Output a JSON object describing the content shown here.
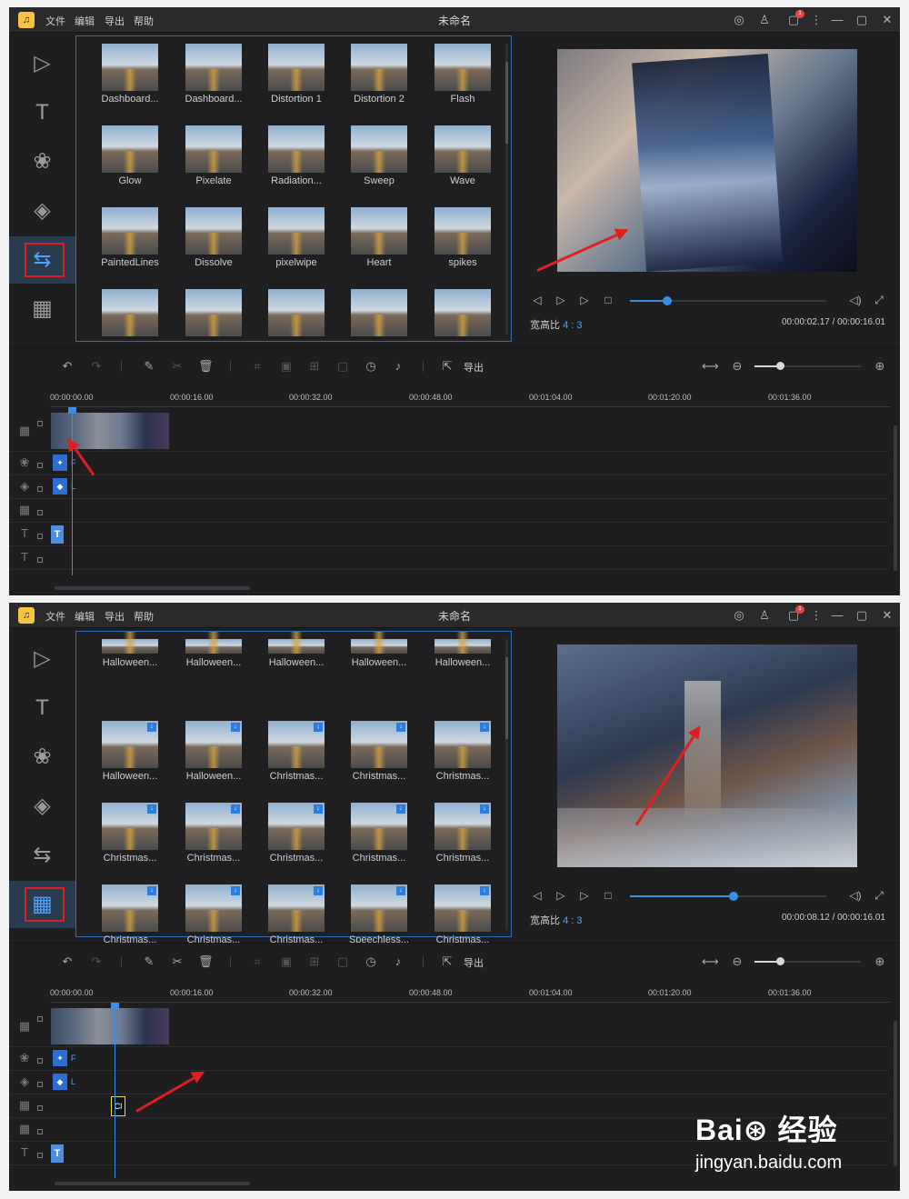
{
  "app": {
    "window_title": "未命名",
    "logo_glyph": "♫",
    "menu": [
      "文件",
      "编辑",
      "导出",
      "帮助"
    ],
    "notification_badge": "1"
  },
  "sidebar": [
    "media",
    "text",
    "filters",
    "overlays",
    "transitions",
    "elements"
  ],
  "screens": [
    {
      "active_sidebar": "transitions",
      "grid_items": [
        "Dashboard...",
        "Dashboard...",
        "Distortion 1",
        "Distortion 2",
        "Flash",
        "Glow",
        "Pixelate",
        "Radiation...",
        "Sweep",
        "Wave",
        "PaintedLines",
        "Dissolve",
        "pixelwipe",
        "Heart",
        "spikes",
        "",
        "",
        "",
        "",
        ""
      ],
      "aspect_label": "宽高比",
      "aspect_value": "4 : 3",
      "time": "00:00:02.17 / 00:00:16.01",
      "progress": 0.19
    },
    {
      "active_sidebar": "elements",
      "grid_items": [
        "Halloween...",
        "Halloween...",
        "Halloween...",
        "Halloween...",
        "Halloween...",
        "Halloween...",
        "Halloween...",
        "Christmas...",
        "Christmas...",
        "Christmas...",
        "Christmas...",
        "Christmas...",
        "Christmas...",
        "Christmas...",
        "Christmas...",
        "Christmas...",
        "Christmas...",
        "Christmas...",
        "Speechless...",
        "Christmas..."
      ],
      "aspect_label": "宽高比",
      "aspect_value": "4 : 3",
      "time": "00:00:08.12 / 00:00:16.01",
      "progress": 0.53
    }
  ],
  "toolbar": {
    "export_label": "导出"
  },
  "ruler_ticks": [
    "00:00:00.00",
    "00:00:16.00",
    "00:00:32.00",
    "00:00:48.00",
    "00:01:04.00",
    "00:01:20.00",
    "00:01:36.00"
  ],
  "timeline_labels": {
    "fx_f": "F",
    "fx_l": "L",
    "title_t": "T",
    "element_clip": "Cl"
  },
  "watermark": {
    "logo_text": "Bai⊛ 经验",
    "url": "jingyan.baidu.com"
  },
  "accent_color": "#3a8ee6",
  "highlight_color": "#e02020"
}
